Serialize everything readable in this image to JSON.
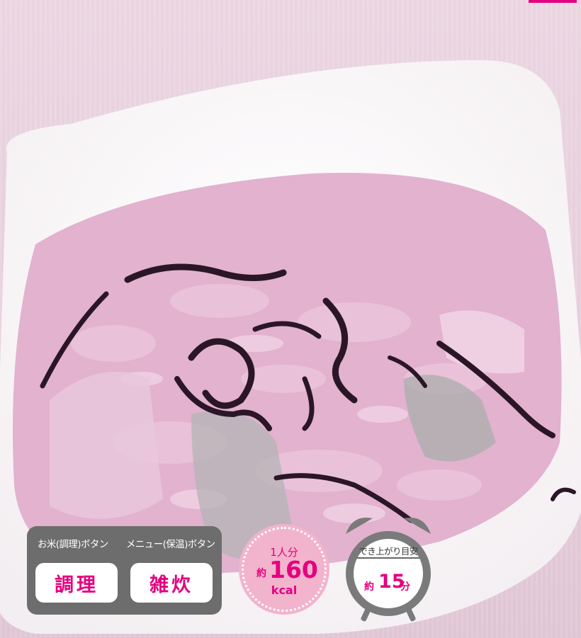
{
  "photo": {
    "subject": "dish-photo"
  },
  "panel": {
    "rice_button_caption": "お米(調理)ボタン",
    "menu_button_caption": "メニュー(保温)ボタン",
    "rice_button_label": "調理",
    "menu_button_label": "雑炊"
  },
  "calorie": {
    "serving": "1人分",
    "approx": "約",
    "value": "160",
    "unit": "kcal"
  },
  "timer": {
    "title": "でき上がり目安",
    "approx": "約",
    "value": "15",
    "unit": "分"
  },
  "colors": {
    "accent": "#e4007f",
    "panel": "#6d6d6d",
    "badge": "#f2b3cc",
    "clock": "#7a7a7a"
  }
}
